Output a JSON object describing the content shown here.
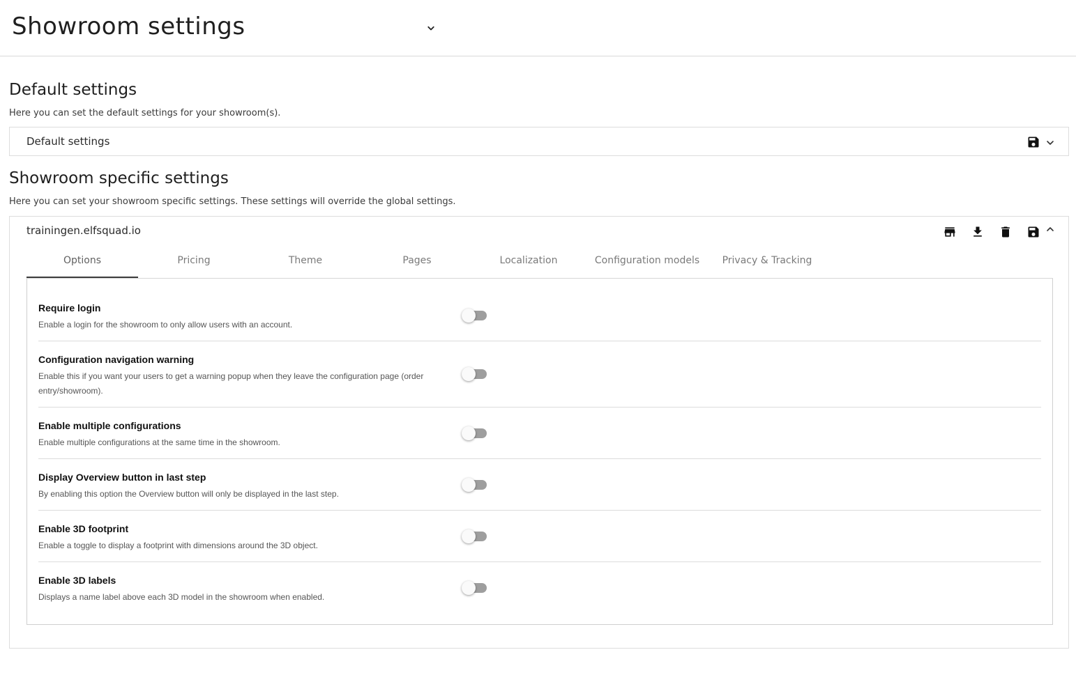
{
  "header": {
    "title": "Showroom settings"
  },
  "default_section": {
    "title": "Default settings",
    "description": "Here you can set the default settings for your showroom(s).",
    "panel_title": "Default settings"
  },
  "specific_section": {
    "title": "Showroom specific settings",
    "description": "Here you can set your showroom specific settings. These settings will override the global settings.",
    "panel_title": "trainingen.elfsquad.io"
  },
  "tabs": [
    {
      "label": "Options",
      "active": true
    },
    {
      "label": "Pricing",
      "active": false
    },
    {
      "label": "Theme",
      "active": false
    },
    {
      "label": "Pages",
      "active": false
    },
    {
      "label": "Localization",
      "active": false
    },
    {
      "label": "Configuration models",
      "active": false
    },
    {
      "label": "Privacy & Tracking",
      "active": false
    }
  ],
  "settings": [
    {
      "label": "Require login",
      "description": "Enable a login for the showroom to only allow users with an account.",
      "enabled": false
    },
    {
      "label": "Configuration navigation warning",
      "description": "Enable this if you want your users to get a warning popup when they leave the configuration page (order entry/showroom).",
      "enabled": false
    },
    {
      "label": "Enable multiple configurations",
      "description": "Enable multiple configurations at the same time in the showroom.",
      "enabled": false
    },
    {
      "label": "Display Overview button in last step",
      "description": "By enabling this option the Overview button will only be displayed in the last step.",
      "enabled": false
    },
    {
      "label": "Enable 3D footprint",
      "description": "Enable a toggle to display a footprint with dimensions around the 3D object.",
      "enabled": false
    },
    {
      "label": "Enable 3D labels",
      "description": "Displays a name label above each 3D model in the showroom when enabled.",
      "enabled": false
    }
  ],
  "icons": {
    "default_panel": [
      "save-icon",
      "chevron-down-icon"
    ],
    "specific_panel": [
      "store-icon",
      "download-icon",
      "delete-icon",
      "save-icon",
      "chevron-up-icon"
    ]
  },
  "colors": {
    "accent": "#3c3c3c",
    "toggle_off_track": "#9e9e9e",
    "toggle_thumb": "#fafafa",
    "border": "#dddddd"
  }
}
